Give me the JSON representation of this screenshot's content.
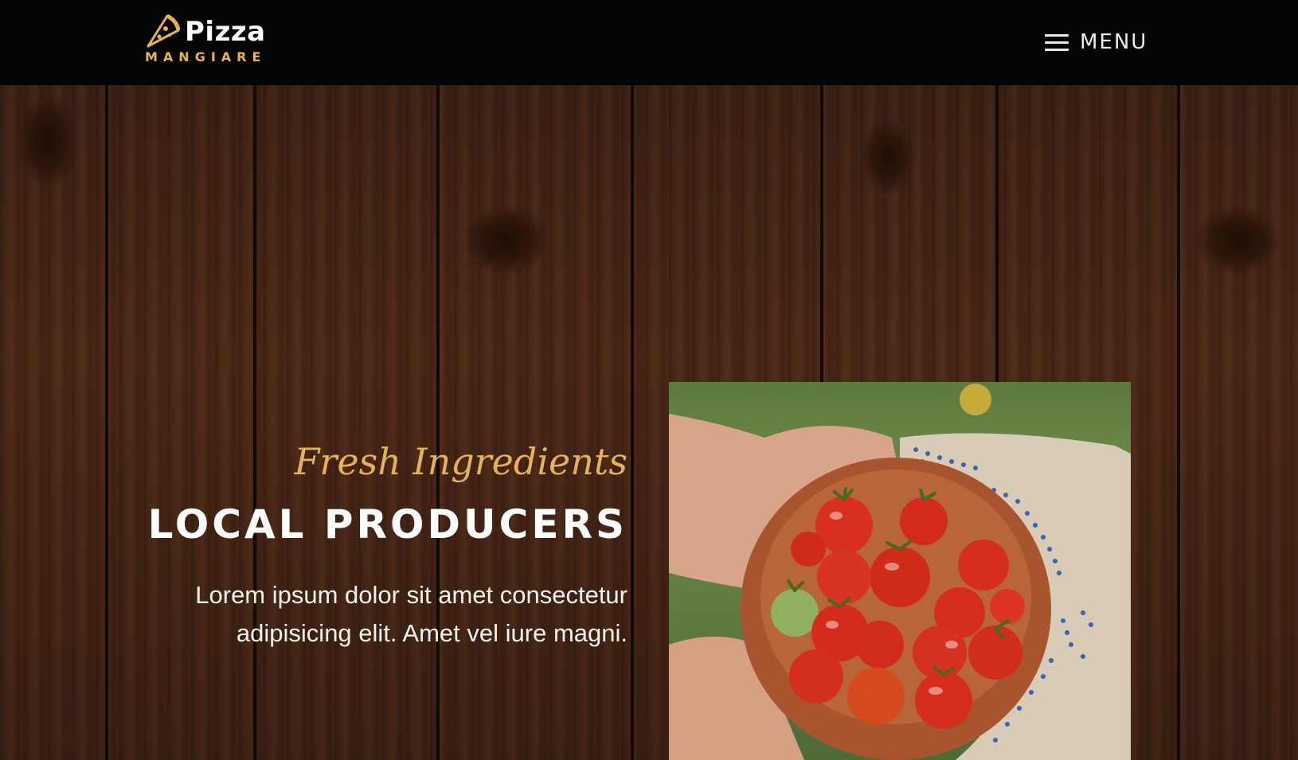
{
  "header": {
    "logo": {
      "title": "Pizza",
      "subtitle": "MANGIARE",
      "icon": "pizza-slice-icon"
    },
    "menu": {
      "label": "MENU",
      "icon": "hamburger-icon"
    }
  },
  "hero": {
    "kicker": "Fresh Ingredients",
    "heading": "LOCAL PRODUCERS",
    "body": "Lorem ipsum dolor sit amet consectetur adipisicing elit. Amet vel iure magni."
  },
  "colors": {
    "header_bg": "#050404",
    "accent_gold": "#e4b359",
    "wood": "#4a2716"
  }
}
